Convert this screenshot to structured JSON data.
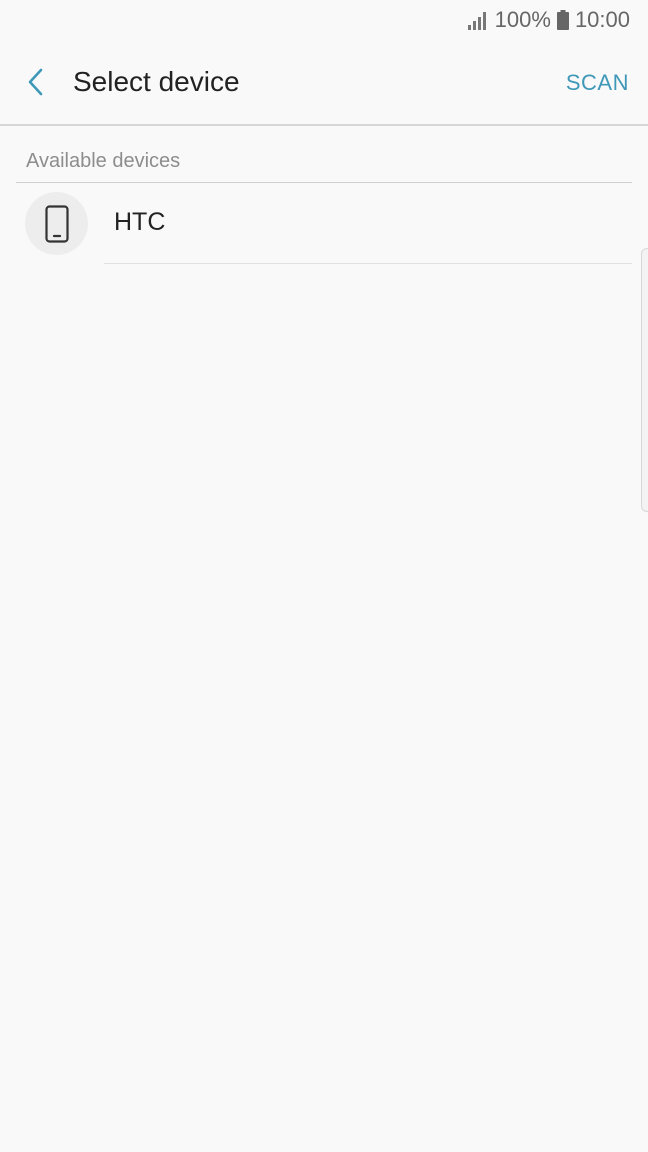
{
  "status_bar": {
    "battery_percent": "100%",
    "time": "10:00",
    "icons": [
      "signal-icon",
      "battery-icon"
    ]
  },
  "app_bar": {
    "title": "Select device",
    "scan_label": "SCAN",
    "back_icon": "chevron-left-icon"
  },
  "section": {
    "label": "Available devices"
  },
  "devices": [
    {
      "name": "HTC",
      "icon": "smartphone-icon"
    }
  ],
  "colors": {
    "accent": "#3f98b8",
    "background": "#f9f9f9",
    "text_primary": "#222222",
    "text_secondary": "#8d8d8d"
  }
}
